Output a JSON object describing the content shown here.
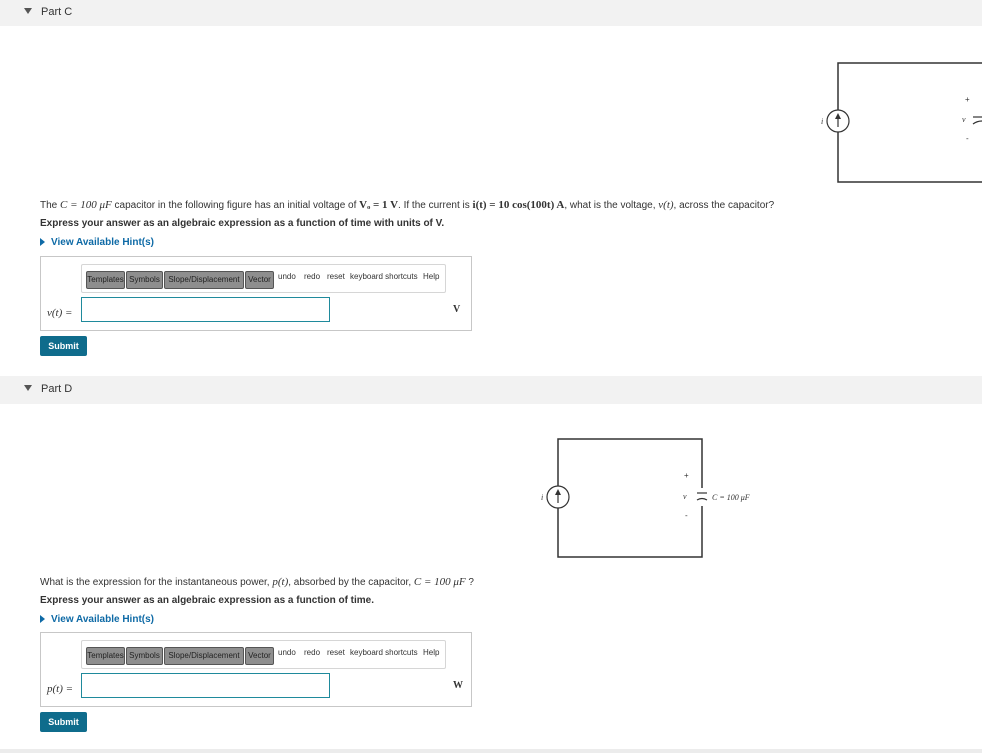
{
  "parts": [
    {
      "header": "Part C",
      "circuit": {
        "source_label": "i",
        "plus": "+",
        "voltage_label": "v",
        "minus": "-"
      },
      "question": {
        "q1": "The ",
        "m1": "C = 100 μF",
        "q2": " capacitor in the following figure has an initial voltage of ",
        "m2": "Vₒ = 1 V",
        "q3": ". If the current is ",
        "m3": "i(t) = 10 cos(100t) A",
        "q4": ", what is the voltage, ",
        "m4": "v(t)",
        "q5": ", across the capacitor?"
      },
      "instruction": "Express your answer as an algebraic expression as a function of time with units of V.",
      "hint": "View Available Hint(s)",
      "toolbar": {
        "templates": "Templates",
        "symbols": "Symbols",
        "slope": "Slope/Displacement",
        "vector": "Vector",
        "undo": "undo",
        "redo": "redo",
        "reset": "reset",
        "shortcuts": "keyboard shortcuts",
        "help": "Help"
      },
      "variable": "v(t) =",
      "input_value": "",
      "units": "V",
      "submit": "Submit"
    },
    {
      "header": "Part D",
      "circuit": {
        "source_label": "i",
        "plus": "+",
        "voltage_label": "v",
        "minus": "-",
        "cap_label": "C = 100 μF"
      },
      "question": {
        "q1": "What is the expression for the instantaneous power, ",
        "m1": "p(t)",
        "q2": ", absorbed by the capacitor, ",
        "m2": "C = 100 μF",
        "q3": " ?"
      },
      "instruction": "Express your answer as an algebraic expression as a function of time.",
      "hint": "View Available Hint(s)",
      "toolbar": {
        "templates": "Templates",
        "symbols": "Symbols",
        "slope": "Slope/Displacement",
        "vector": "Vector",
        "undo": "undo",
        "redo": "redo",
        "reset": "reset",
        "shortcuts": "keyboard shortcuts",
        "help": "Help"
      },
      "variable": "p(t) =",
      "input_value": "",
      "units": "W",
      "submit": "Submit"
    }
  ]
}
